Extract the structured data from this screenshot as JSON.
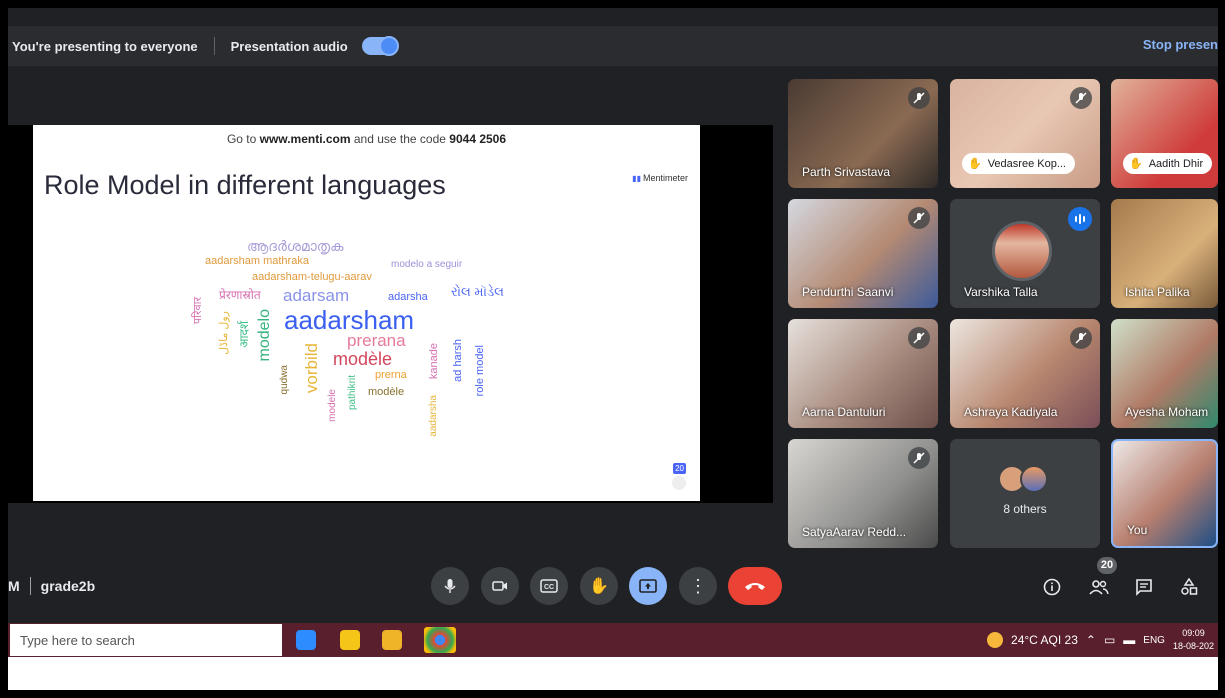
{
  "presenting_bar": {
    "status_text": "You're presenting to everyone",
    "audio_label": "Presentation audio",
    "audio_toggle_on": true,
    "stop_label": "Stop presen"
  },
  "slide": {
    "instruction_prefix": "Go to ",
    "instruction_site": "www.menti.com",
    "instruction_mid": " and use the code ",
    "instruction_code": "9044 2506",
    "title": "Role Model in different languages",
    "brand": "Mentimeter",
    "response_count": "20",
    "word_cloud": [
      "ആദർശമാതൃക",
      "aadarsham mathraka",
      "modelo a seguir",
      "aadarsham-telugu-aarav",
      "प्रेरणास्रोत",
      "adarsam",
      "adarsha",
      "રોલ મૉડેલ",
      "परिवार",
      "رول ماڈل",
      "आदर्श",
      "modelo",
      "aadarsham",
      "prerana",
      "qudwa",
      "vorbild",
      "modèle",
      "prerna",
      "kanade",
      "ad harsh",
      "role model",
      "pathikrit",
      "modèle",
      "modele",
      "aadarsha"
    ]
  },
  "participants": [
    {
      "name": "Parth Srivastava",
      "muted": true,
      "hand_raised": false
    },
    {
      "name": "Vedasree Kop...",
      "muted": true,
      "hand_raised": true
    },
    {
      "name": "Aadith Dhir",
      "muted": false,
      "hand_raised": true
    },
    {
      "name": "Pendurthi Saanvi",
      "muted": true,
      "hand_raised": false
    },
    {
      "name": "Varshika Talla",
      "muted": false,
      "hand_raised": false,
      "speaking": true
    },
    {
      "name": "Ishita Palika",
      "muted": false,
      "hand_raised": false
    },
    {
      "name": "Aarna Dantuluri",
      "muted": true,
      "hand_raised": false
    },
    {
      "name": "Ashraya Kadiyala",
      "muted": true,
      "hand_raised": false
    },
    {
      "name": "Ayesha Moham",
      "muted": false,
      "hand_raised": false
    },
    {
      "name": "SatyaAarav Redd...",
      "muted": true,
      "hand_raised": false
    },
    {
      "name": "8 others"
    },
    {
      "name": "You"
    }
  ],
  "meeting": {
    "time_fragment": "M",
    "code": "grade2b",
    "people_count": "20"
  },
  "controls": [
    {
      "name": "mic-button",
      "icon": "mic-icon"
    },
    {
      "name": "camera-button",
      "icon": "video-icon"
    },
    {
      "name": "captions-button",
      "icon": "cc-icon"
    },
    {
      "name": "raise-hand-button",
      "icon": "hand-icon"
    },
    {
      "name": "present-button",
      "icon": "present-icon"
    },
    {
      "name": "more-options-button",
      "icon": "more-vert-icon"
    },
    {
      "name": "end-call-button",
      "icon": "phone-hangup-icon"
    }
  ],
  "right_controls": [
    {
      "name": "info-button",
      "icon": "info-icon"
    },
    {
      "name": "people-button",
      "icon": "people-icon"
    },
    {
      "name": "chat-button",
      "icon": "chat-icon"
    },
    {
      "name": "activities-button",
      "icon": "shapes-icon"
    }
  ],
  "taskbar": {
    "search_placeholder": "Type here to search",
    "weather": "24°C  AQI 23",
    "language": "ENG",
    "time": "09:09",
    "date": "18-08-202"
  },
  "colors": {
    "accent": "#8ab4f8",
    "end_call": "#ea4335",
    "speaking": "#1a73e8",
    "background": "#202124",
    "taskbar": "#5a1f2d"
  }
}
